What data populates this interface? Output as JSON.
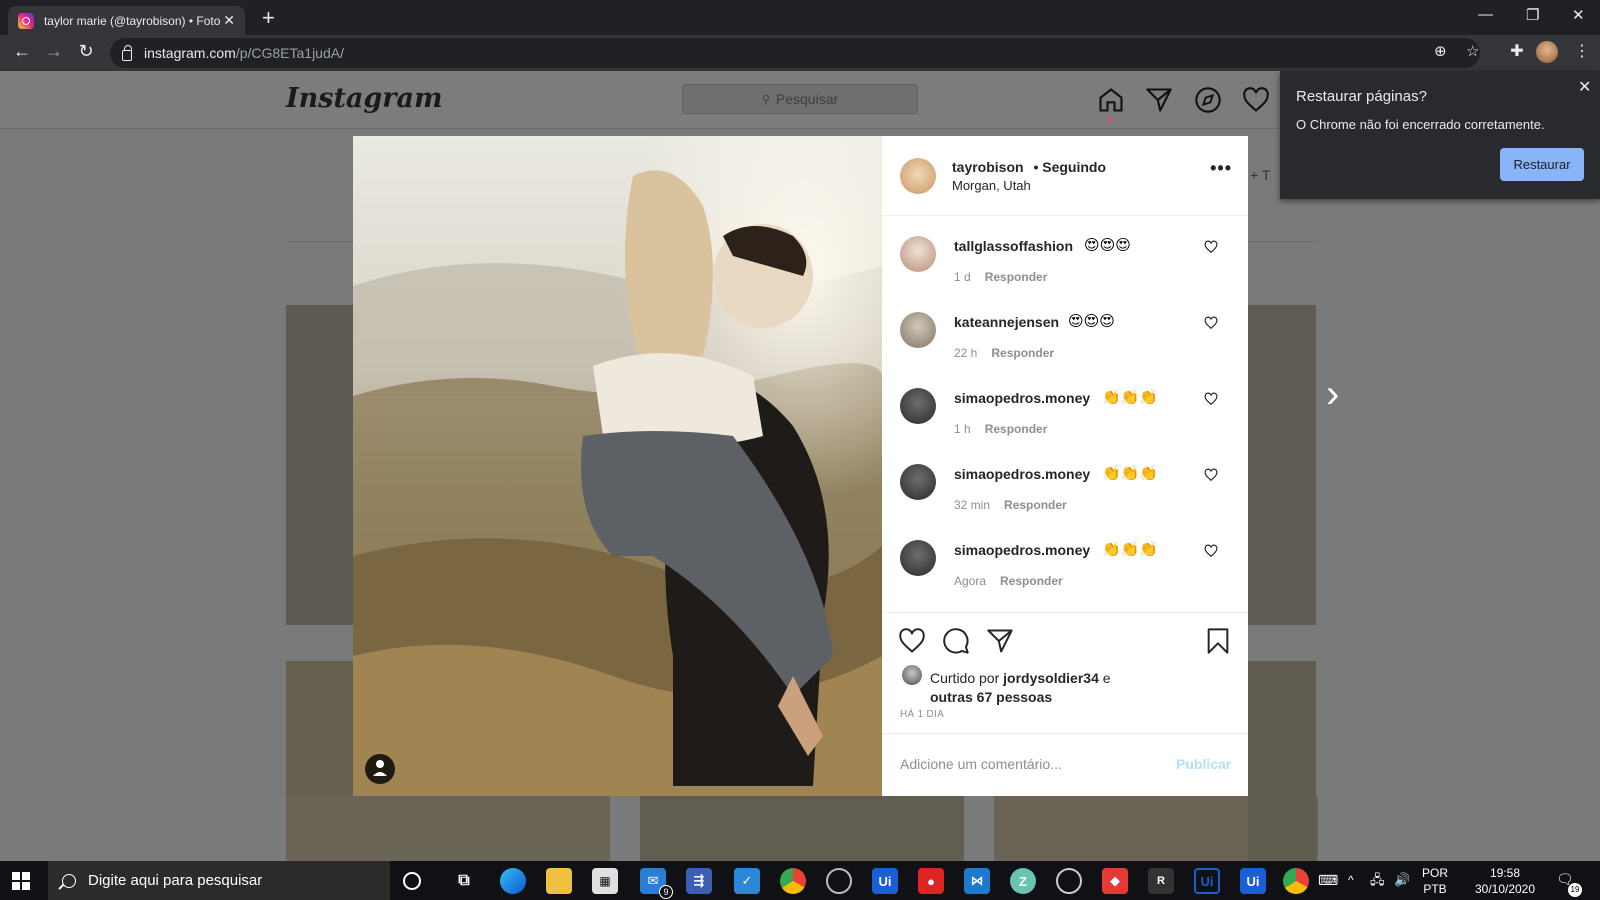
{
  "browser": {
    "tab_title": "taylor marie (@tayrobison) • Foto",
    "url_host": "instagram.com",
    "url_path": "/p/CG8ETa1judA/"
  },
  "instagram": {
    "logo": "Instagram",
    "search_placeholder": "Pesquisar"
  },
  "post": {
    "author": "tayrobison",
    "follow_status": "• Seguindo",
    "location": "Morgan, Utah",
    "more_label": "•••",
    "comments": [
      {
        "user": "tallglassoffashion",
        "text": "😍😍😍",
        "time": "1 d",
        "reply": "Responder"
      },
      {
        "user": "kateannejensen",
        "text": "😍😍😍",
        "time": "22 h",
        "reply": "Responder"
      },
      {
        "user": "simaopedros.money",
        "text": "👏👏👏",
        "time": "1 h",
        "reply": "Responder"
      },
      {
        "user": "simaopedros.money",
        "text": "👏👏👏",
        "time": "32 min",
        "reply": "Responder"
      },
      {
        "user": "simaopedros.money",
        "text": "👏👏👏",
        "time": "Agora",
        "reply": "Responder"
      }
    ],
    "liked_prefix": "Curtido por",
    "liked_user": "jordysoldier34",
    "liked_suffix": "e",
    "liked_others": "outras 67 pessoas",
    "timestamp": "HÁ 1 DIA",
    "comment_placeholder": "Adicione um comentário...",
    "publish_label": "Publicar"
  },
  "restore_popup": {
    "title": "Restaurar páginas?",
    "message": "O Chrome não foi encerrado corretamente.",
    "button": "Restaurar"
  },
  "taskbar": {
    "search_placeholder": "Digite aqui para pesquisar",
    "language": "POR",
    "keyboard": "PTB",
    "time": "19:58",
    "date": "30/10/2020",
    "notification_count": "19",
    "mail_badge": "9"
  },
  "colors": {
    "accent_blue": "#8ab4f8",
    "publish_disabled": "#b2dffc",
    "like_dot": "#ed4956"
  }
}
